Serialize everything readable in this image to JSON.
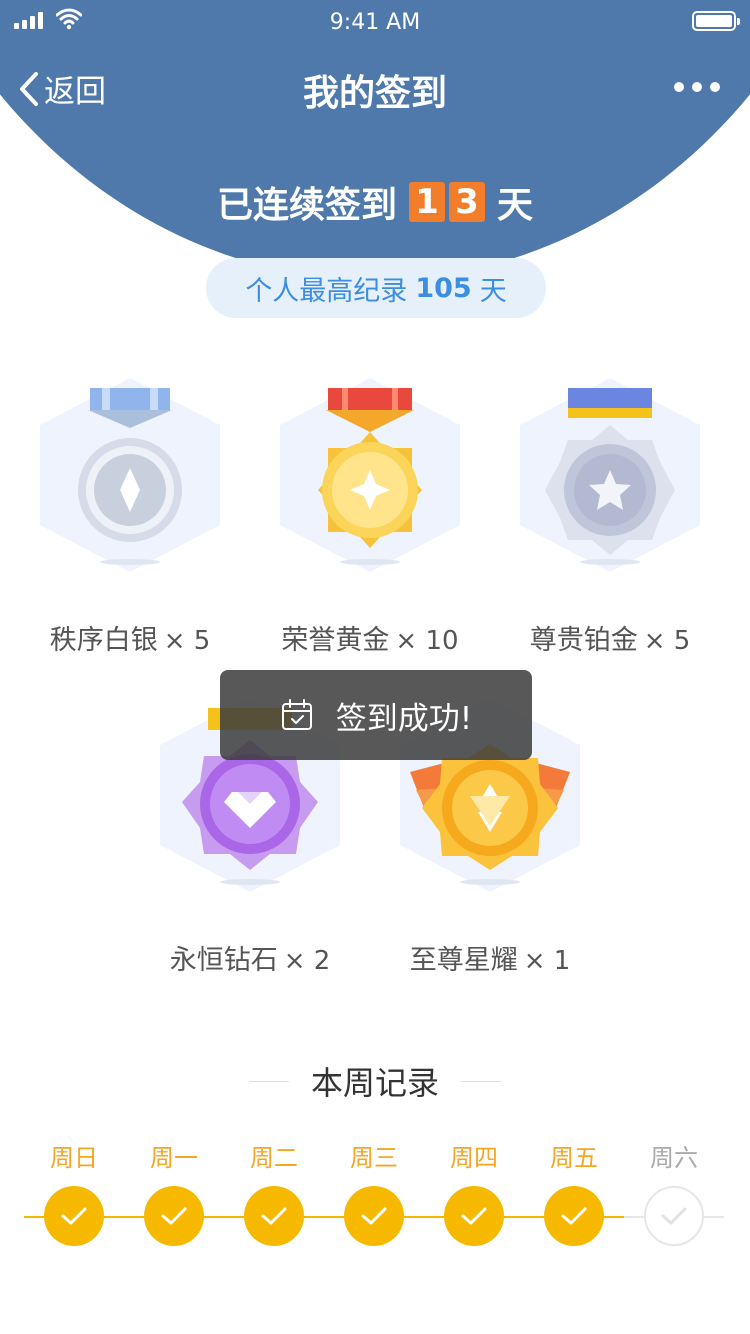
{
  "status_bar": {
    "time": "9:41 AM"
  },
  "nav": {
    "back_label": "返回",
    "title": "我的签到"
  },
  "streak": {
    "prefix": "已连续签到",
    "digits": [
      "1",
      "3"
    ],
    "suffix": "天"
  },
  "record": {
    "label": "个人最高纪录",
    "value": "105",
    "unit": "天"
  },
  "medals": [
    {
      "name": "秩序白银",
      "count": "× 5",
      "icon": "silver-medal-icon"
    },
    {
      "name": "荣誉黄金",
      "count": "× 10",
      "icon": "gold-medal-icon"
    },
    {
      "name": "尊贵铂金",
      "count": "× 5",
      "icon": "platinum-medal-icon"
    },
    {
      "name": "永恒钻石",
      "count": "× 2",
      "icon": "diamond-medal-icon"
    },
    {
      "name": "至尊星耀",
      "count": "× 1",
      "icon": "star-medal-icon"
    }
  ],
  "toast": {
    "text": "签到成功!",
    "icon": "calendar-check-icon"
  },
  "week": {
    "title": "本周记录",
    "days": [
      {
        "label": "周日",
        "checked": true
      },
      {
        "label": "周一",
        "checked": true
      },
      {
        "label": "周二",
        "checked": true
      },
      {
        "label": "周三",
        "checked": true
      },
      {
        "label": "周四",
        "checked": true
      },
      {
        "label": "周五",
        "checked": true
      },
      {
        "label": "周六",
        "checked": false
      }
    ]
  },
  "colors": {
    "header": "#4f79ab",
    "accent": "#f5b800",
    "digit_bg": "#f27d2a",
    "record_text": "#3d8de0"
  }
}
